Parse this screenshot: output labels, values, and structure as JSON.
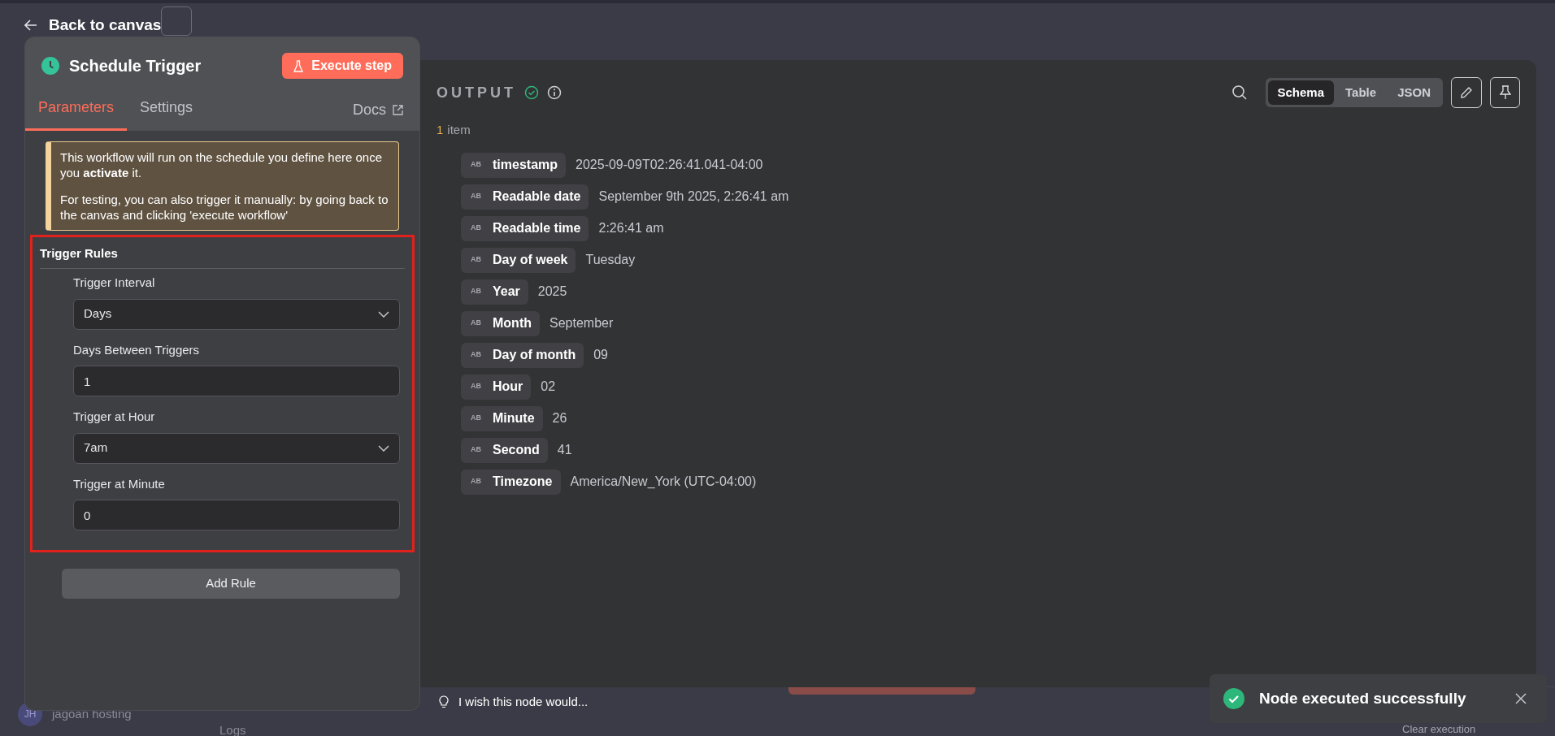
{
  "back_link": {
    "label": "Back to canvas"
  },
  "background": {
    "user_initials": "JH",
    "user_name": "jagoan hosting",
    "logs_label": "Logs",
    "clear_label": "Clear execution"
  },
  "node_panel": {
    "title": "Schedule Trigger",
    "execute_button": "Execute step",
    "tabs": [
      {
        "label": "Parameters",
        "selected": true
      },
      {
        "label": "Settings",
        "selected": false
      }
    ],
    "docs_link": "Docs",
    "notice": [
      "This workflow will run on the schedule you define here once you **activate** it.",
      "For testing, you can also trigger it manually: by going back to the canvas and clicking 'execute workflow'"
    ],
    "section_title": "Trigger Rules",
    "fields": [
      {
        "label": "Trigger Interval",
        "kind": "select",
        "value": "Days"
      },
      {
        "label": "Days Between Triggers",
        "kind": "input",
        "value": "1"
      },
      {
        "label": "Trigger at Hour",
        "kind": "select",
        "value": "7am"
      },
      {
        "label": "Trigger at Minute",
        "kind": "input",
        "value": "0"
      }
    ],
    "add_button": "Add Rule"
  },
  "output": {
    "title": "OUTPUT",
    "count": "1",
    "count_label": "item",
    "views": [
      {
        "label": "Schema",
        "selected": true
      },
      {
        "label": "Table",
        "selected": false
      },
      {
        "label": "JSON",
        "selected": false
      }
    ],
    "fields": [
      {
        "type": "AB",
        "key": "timestamp",
        "value": "2025-09-09T02:26:41.041-04:00"
      },
      {
        "type": "AB",
        "key": "Readable date",
        "value": "September 9th 2025, 2:26:41 am"
      },
      {
        "type": "AB",
        "key": "Readable time",
        "value": "2:26:41 am"
      },
      {
        "type": "AB",
        "key": "Day of week",
        "value": "Tuesday"
      },
      {
        "type": "AB",
        "key": "Year",
        "value": "2025"
      },
      {
        "type": "AB",
        "key": "Month",
        "value": "September"
      },
      {
        "type": "AB",
        "key": "Day of month",
        "value": "09"
      },
      {
        "type": "AB",
        "key": "Hour",
        "value": "02"
      },
      {
        "type": "AB",
        "key": "Minute",
        "value": "26"
      },
      {
        "type": "AB",
        "key": "Second",
        "value": "41"
      },
      {
        "type": "AB",
        "key": "Timezone",
        "value": "America/New_York (UTC-04:00)"
      }
    ]
  },
  "feedback": {
    "label": "I wish this node would..."
  },
  "toast": {
    "message": "Node executed successfully"
  }
}
